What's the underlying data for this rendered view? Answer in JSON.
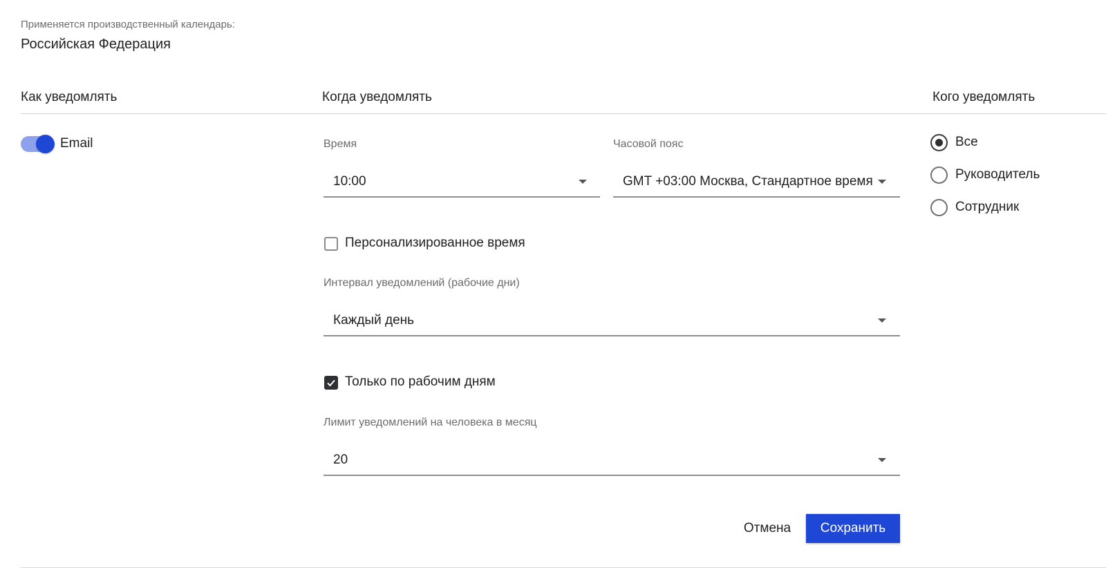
{
  "calendar": {
    "label": "Применяется производственный календарь:",
    "value": "Российская Федерация"
  },
  "columns": {
    "how": "Как уведомлять",
    "when": "Когда уведомлять",
    "who": "Кого уведомлять"
  },
  "channels": {
    "email": {
      "label": "Email",
      "enabled": true
    }
  },
  "schedule": {
    "time": {
      "label": "Время",
      "value": "10:00"
    },
    "timezone": {
      "label": "Часовой пояс",
      "value": "GMT +03:00 Москва, Стандартное время"
    },
    "personalized_time": {
      "label": "Персонализированное время",
      "checked": false
    },
    "interval": {
      "label": "Интервал уведомлений (рабочие дни)",
      "value": "Каждый день"
    },
    "workdays_only": {
      "label": "Только по рабочим дням",
      "checked": true
    },
    "limit": {
      "label": "Лимит уведомлений на человека в месяц",
      "value": "20"
    }
  },
  "recipients": {
    "options": [
      {
        "label": "Все",
        "selected": true
      },
      {
        "label": "Руководитель",
        "selected": false
      },
      {
        "label": "Сотрудник",
        "selected": false
      }
    ]
  },
  "actions": {
    "cancel_label": "Отмена",
    "save_label": "Сохранить"
  },
  "colors": {
    "accent": "#1f47d6",
    "toggle_track": "#8ea2ec",
    "toggle_knob": "#1f47d6"
  },
  "icons": {
    "dropdown": "chevron-down-icon",
    "check": "check-icon"
  }
}
